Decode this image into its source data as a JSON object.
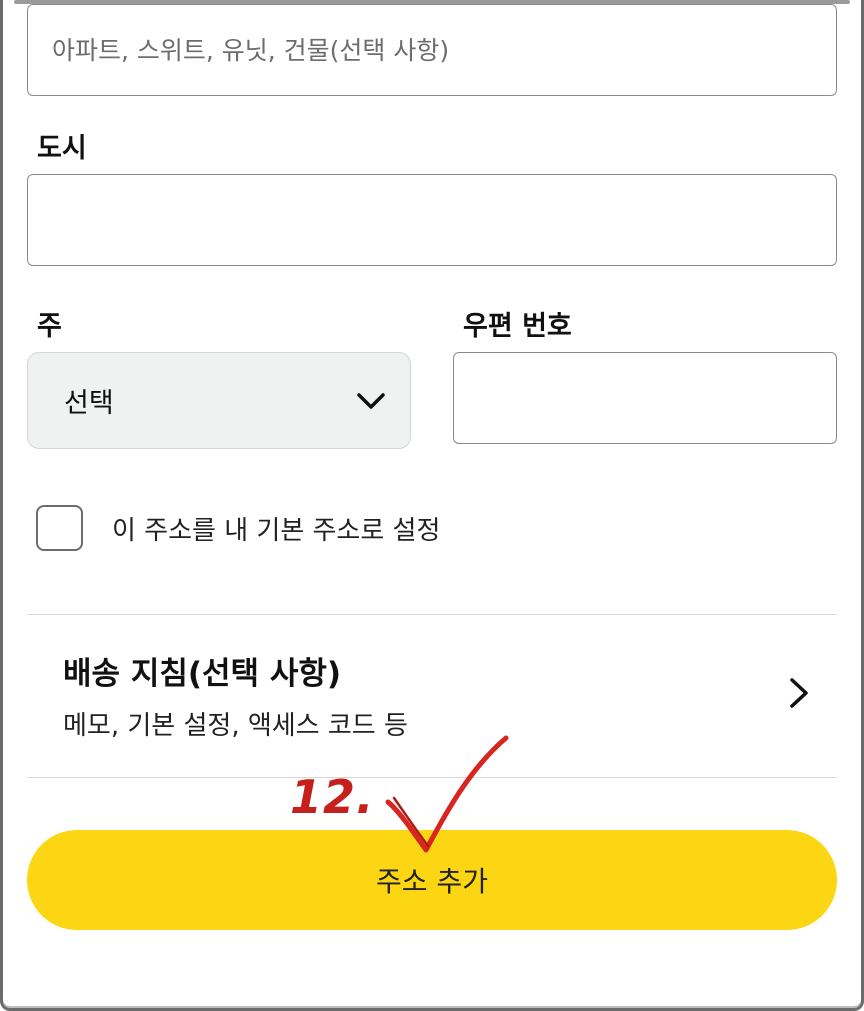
{
  "address2": {
    "placeholder": "아파트, 스위트, 유닛, 건물(선택 사항)"
  },
  "city": {
    "label": "도시",
    "value": ""
  },
  "state": {
    "label": "주",
    "selected": "선택"
  },
  "postal": {
    "label": "우편 번호",
    "value": ""
  },
  "default_checkbox": {
    "label": "이 주소를 내 기본 주소로 설정",
    "checked": false
  },
  "delivery": {
    "title": "배송 지침(선택 사항)",
    "subtitle": "메모, 기본 설정, 액세스 코드 등"
  },
  "add_button": {
    "label": "주소 추가"
  },
  "annotation": {
    "step": "12.",
    "color": "#c6201d"
  },
  "colors": {
    "button": "#fcd612",
    "select_bg": "#f0f2f2"
  }
}
